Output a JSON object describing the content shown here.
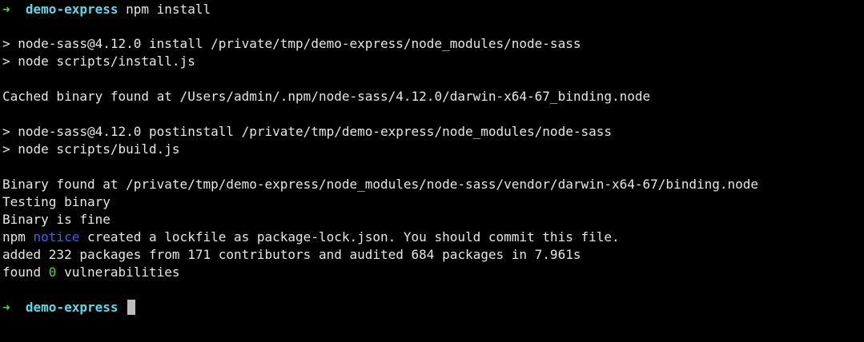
{
  "prompt": {
    "arrow": "➜",
    "dir": "demo-express",
    "command": "npm install"
  },
  "output": {
    "l1": "> node-sass@4.12.0 install /private/tmp/demo-express/node_modules/node-sass",
    "l2": "> node scripts/install.js",
    "l3": "Cached binary found at /Users/admin/.npm/node-sass/4.12.0/darwin-x64-67_binding.node",
    "l4": "> node-sass@4.12.0 postinstall /private/tmp/demo-express/node_modules/node-sass",
    "l5": "> node scripts/build.js",
    "l6": "Binary found at /private/tmp/demo-express/node_modules/node-sass/vendor/darwin-x64-67/binding.node",
    "l7": "Testing binary",
    "l8": "Binary is fine",
    "npm_prefix": "npm ",
    "npm_notice": "notice",
    "npm_rest": " created a lockfile as package-lock.json. You should commit this file.",
    "l10": "added 232 packages from 171 contributors and audited 684 packages in 7.961s",
    "found_prefix": "found ",
    "found_count": "0",
    "found_suffix": " vulnerabilities"
  },
  "prompt2": {
    "arrow": "➜",
    "dir": "demo-express"
  },
  "colors": {
    "background": "#000000",
    "text": "#e6e6e6",
    "prompt_arrow": "#4fd36f",
    "prompt_dir": "#5fd7e6",
    "npm_notice": "#3f62e8",
    "vuln_count": "#4fd36f",
    "cursor": "#bdbdbd"
  }
}
